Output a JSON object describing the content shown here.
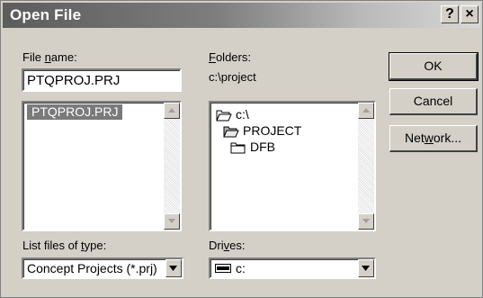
{
  "window": {
    "title": "Open File",
    "help_label": "?",
    "close_label": "×"
  },
  "file_name": {
    "label_pre": "File ",
    "label_key": "n",
    "label_post": "ame:",
    "value": "PTQPROJ.PRJ"
  },
  "file_list": {
    "items": [
      "PTQPROJ.PRJ"
    ],
    "selected": "PTQPROJ.PRJ"
  },
  "folders": {
    "label_key": "F",
    "label_post": "olders:",
    "current_path": "c:\\project",
    "tree": [
      {
        "name": "c:\\",
        "icon": "open-folder-icon"
      },
      {
        "name": "PROJECT",
        "icon": "open-folder-icon"
      },
      {
        "name": "DFB",
        "icon": "closed-folder-icon"
      }
    ]
  },
  "buttons": {
    "ok": "OK",
    "cancel": "Cancel",
    "network_pre": "Net",
    "network_key": "w",
    "network_post": "ork..."
  },
  "file_type": {
    "label_pre": "List files of ",
    "label_key": "t",
    "label_post": "ype:",
    "value": "Concept Projects (*.prj)"
  },
  "drives": {
    "label_pre": "Dri",
    "label_key": "v",
    "label_post": "es:",
    "value": "c:",
    "icon": "hard-drive-icon"
  },
  "colors": {
    "face": "#d4d0c8",
    "selection": "#7a7a7a",
    "titlebar_start": "#5c5c5c"
  }
}
